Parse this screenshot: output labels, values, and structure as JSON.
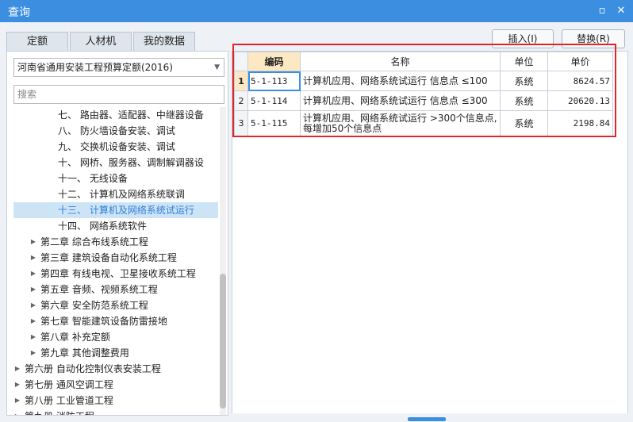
{
  "window": {
    "title": "查询",
    "restore_icon": "▫",
    "close_icon": "✕"
  },
  "tabs": [
    {
      "label": "定额",
      "active": true
    },
    {
      "label": "人材机",
      "active": false
    },
    {
      "label": "我的数据",
      "active": false
    }
  ],
  "library": {
    "selected": "河南省通用安装工程预算定额(2016)"
  },
  "search": {
    "placeholder": "搜索"
  },
  "tree": [
    {
      "label": "七、 路由器、适配器、中继器设备",
      "indent": 2,
      "arrow": false,
      "selected": false
    },
    {
      "label": "八、 防火墙设备安装、调试",
      "indent": 2,
      "arrow": false,
      "selected": false
    },
    {
      "label": "九、 交换机设备安装、调试",
      "indent": 2,
      "arrow": false,
      "selected": false
    },
    {
      "label": "十、 网桥、服务器、调制解调器设",
      "indent": 2,
      "arrow": false,
      "selected": false
    },
    {
      "label": "十一、 无线设备",
      "indent": 2,
      "arrow": false,
      "selected": false
    },
    {
      "label": "十二、 计算机及网络系统联调",
      "indent": 2,
      "arrow": false,
      "selected": false
    },
    {
      "label": "十三、 计算机及网络系统试运行",
      "indent": 2,
      "arrow": false,
      "selected": true
    },
    {
      "label": "十四、 网络系统软件",
      "indent": 2,
      "arrow": false,
      "selected": false
    },
    {
      "label": "第二章 综合布线系统工程",
      "indent": 1,
      "arrow": true,
      "selected": false
    },
    {
      "label": "第三章 建筑设备自动化系统工程",
      "indent": 1,
      "arrow": true,
      "selected": false
    },
    {
      "label": "第四章 有线电视、卫星接收系统工程",
      "indent": 1,
      "arrow": true,
      "selected": false
    },
    {
      "label": "第五章 音频、视频系统工程",
      "indent": 1,
      "arrow": true,
      "selected": false
    },
    {
      "label": "第六章 安全防范系统工程",
      "indent": 1,
      "arrow": true,
      "selected": false
    },
    {
      "label": "第七章 智能建筑设备防雷接地",
      "indent": 1,
      "arrow": true,
      "selected": false
    },
    {
      "label": "第八章 补充定额",
      "indent": 1,
      "arrow": true,
      "selected": false
    },
    {
      "label": "第九章 其他调整费用",
      "indent": 1,
      "arrow": true,
      "selected": false
    },
    {
      "label": "第六册 自动化控制仪表安装工程",
      "indent": 0,
      "arrow": true,
      "selected": false
    },
    {
      "label": "第七册 通风空调工程",
      "indent": 0,
      "arrow": true,
      "selected": false
    },
    {
      "label": "第八册 工业管道工程",
      "indent": 0,
      "arrow": true,
      "selected": false
    },
    {
      "label": "第九册 消防工程",
      "indent": 0,
      "arrow": true,
      "selected": false
    }
  ],
  "toolbar": {
    "insert_label": "插入(I)",
    "replace_label": "替换(R)"
  },
  "grid": {
    "headers": {
      "code": "编码",
      "name": "名称",
      "unit": "单位",
      "price": "单价"
    },
    "rows": [
      {
        "n": "1",
        "code": "5-1-113",
        "name": "计算机应用、网络系统试运行 信息点 ≤100",
        "unit": "系统",
        "price": "8624.57"
      },
      {
        "n": "2",
        "code": "5-1-114",
        "name": "计算机应用、网络系统试运行 信息点 ≤300",
        "unit": "系统",
        "price": "20620.13"
      },
      {
        "n": "3",
        "code": "5-1-115",
        "name": "计算机应用、网络系统试运行 >300个信息点,每增加50个信息点",
        "unit": "系统",
        "price": "2198.84"
      }
    ]
  },
  "colors": {
    "accent": "#3b8ee0",
    "highlight": "#e0262b",
    "selected_row": "#cde4f7"
  }
}
